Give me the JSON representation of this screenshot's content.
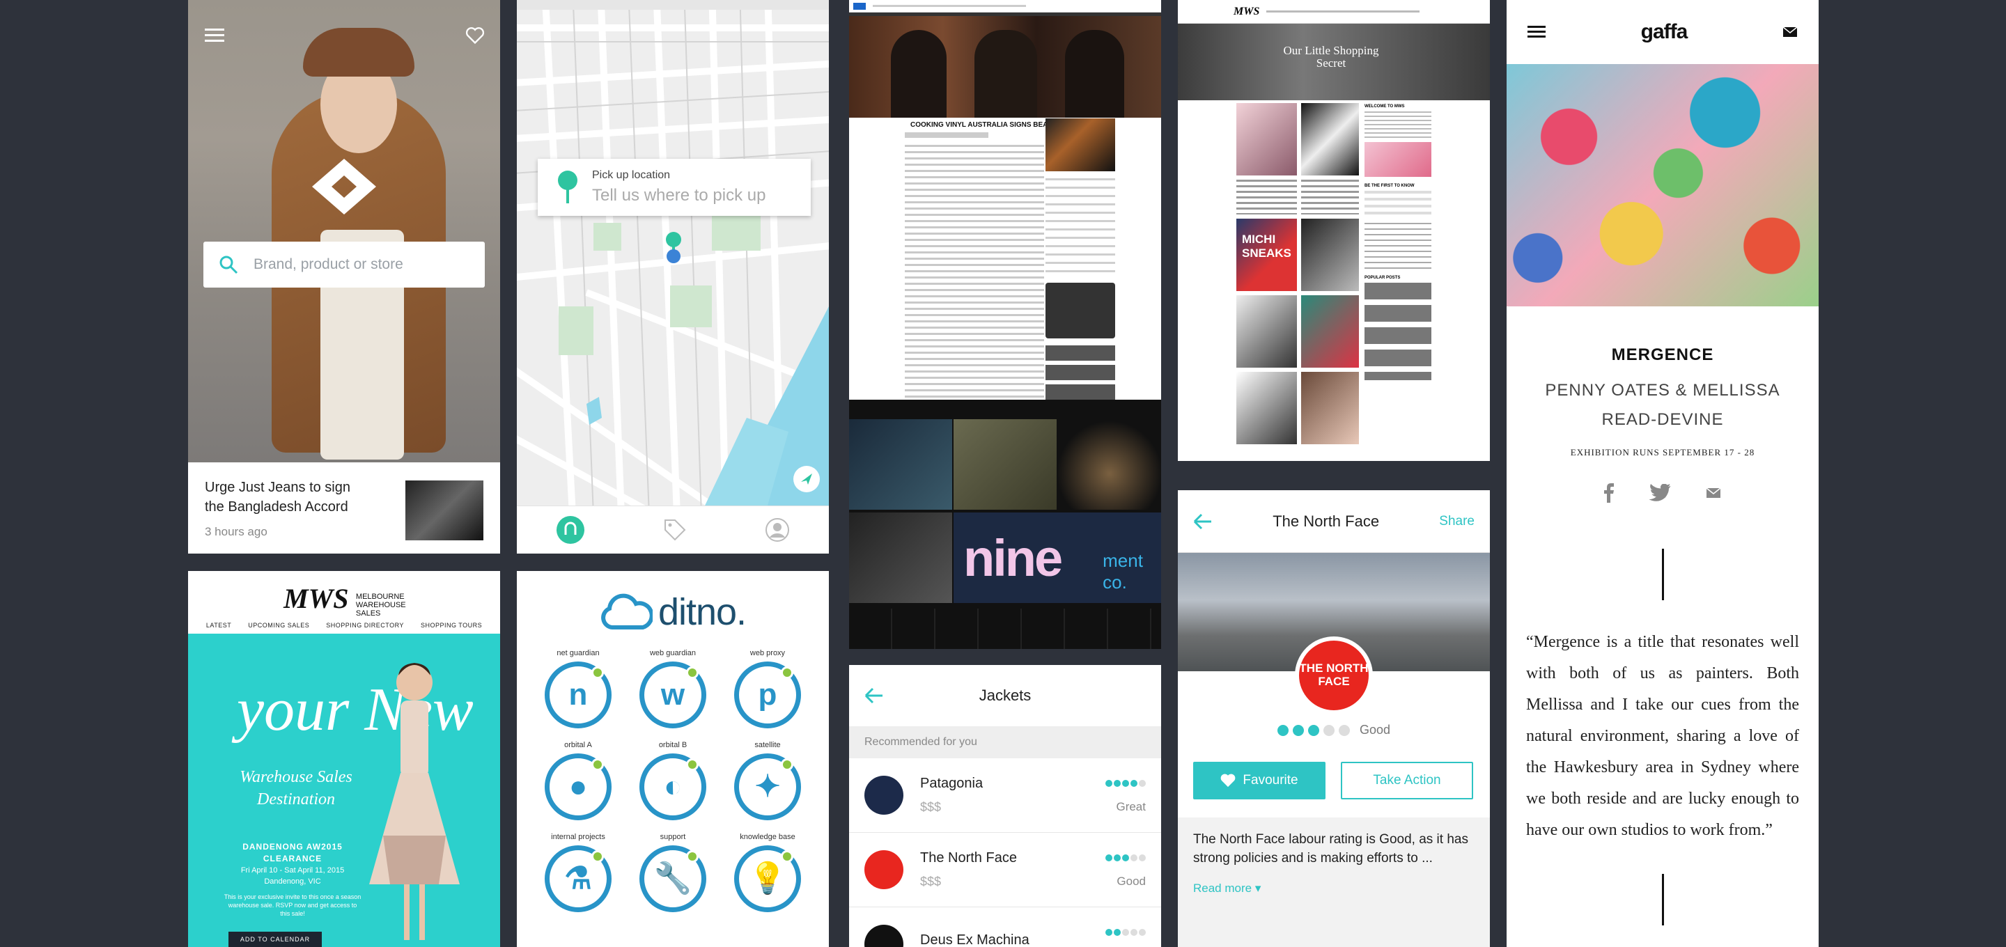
{
  "card1": {
    "search_placeholder": "Brand, product or store",
    "news_title": "Urge Just Jeans to sign the Bangladesh Accord",
    "news_time": "3 hours ago"
  },
  "card2": {
    "pickup_label": "Pick up location",
    "pickup_placeholder": "Tell us where to pick up"
  },
  "card3": {
    "headline": "COOKING VINYL AUSTRALIA SIGNS BEACH SLANG",
    "brand": "nine",
    "brand_sub": "ment co."
  },
  "card4": {
    "logo": "MWS",
    "hero_text": "Our Little Shopping Secret",
    "side_title": "WELCOME TO MWS",
    "signup": "BE THE FIRST TO KNOW",
    "popular": "POPULAR POSTS",
    "tile_text": "MICHI SNEAKS"
  },
  "card5": {
    "title": "The North Face",
    "share": "Share",
    "logo_text": "THE NORTH FACE",
    "rating_label": "Good",
    "rating": 3,
    "rating_max": 5,
    "favourite": "Favourite",
    "take_action": "Take Action",
    "description": "The North Face labour rating is Good, as it has strong policies and is making efforts to ...",
    "read_more": "Read more"
  },
  "card6": {
    "brand": "gaffa",
    "title": "MERGENCE",
    "artists": "PENNY OATES & MELLISSA READ-DEVINE",
    "runs": "EXHIBITION RUNS SEPTEMBER 17 - 28",
    "quote": "“Mergence is a title that resonates well with both of us as painters. Both Mellissa and I take our cues from the natural environment, sharing a love of the Hawkesbury area in Sydney where we both reside and are lucky enough to have our own studios to work from.”"
  },
  "card7": {
    "logo": "MWS",
    "logo_sub": "MELBOURNE WAREHOUSE SALES",
    "nav": [
      "LATEST",
      "UPCOMING SALES",
      "SHOPPING DIRECTORY",
      "SHOPPING TOURS"
    ],
    "script": "your New",
    "tagline": "Warehouse Sales Destination",
    "sale_title": "DANDENONG AW2015 CLEARANCE",
    "sale_dates": "Fri April 10 - Sat April 11, 2015",
    "sale_place": "Dandenong, VIC",
    "sale_text": "This is your exclusive invite to this once a season warehouse sale. RSVP now and get access to this sale!",
    "calendar": "ADD TO CALENDAR"
  },
  "card8": {
    "logo": "ditno.",
    "items": [
      {
        "label": "net guardian",
        "glyph": "n"
      },
      {
        "label": "web guardian",
        "glyph": "w"
      },
      {
        "label": "web proxy",
        "glyph": "p"
      },
      {
        "label": "orbital A",
        "glyph": "●"
      },
      {
        "label": "orbital B",
        "glyph": "◐"
      },
      {
        "label": "satellite",
        "glyph": "✦"
      },
      {
        "label": "internal projects",
        "glyph": "⚗"
      },
      {
        "label": "support",
        "glyph": "🔧"
      },
      {
        "label": "knowledge base",
        "glyph": "💡"
      }
    ]
  },
  "card9": {
    "title": "Jackets",
    "recommended": "Recommended for you",
    "rows": [
      {
        "name": "Patagonia",
        "price": "$$$",
        "word": "Great",
        "rating": 4,
        "color": "#1c2a4a"
      },
      {
        "name": "The North Face",
        "price": "$$$",
        "word": "Good",
        "rating": 3,
        "color": "#e8261f"
      },
      {
        "name": "Deus Ex Machina",
        "price": "",
        "word": "",
        "rating": 2,
        "color": "#111111"
      }
    ]
  },
  "colors": {
    "accent": "#2ec4c4",
    "ditno_blue": "#2894c8",
    "ditno_green": "#8bc53f",
    "mws_teal": "#2cd0cc",
    "tnf_red": "#e8261f"
  }
}
